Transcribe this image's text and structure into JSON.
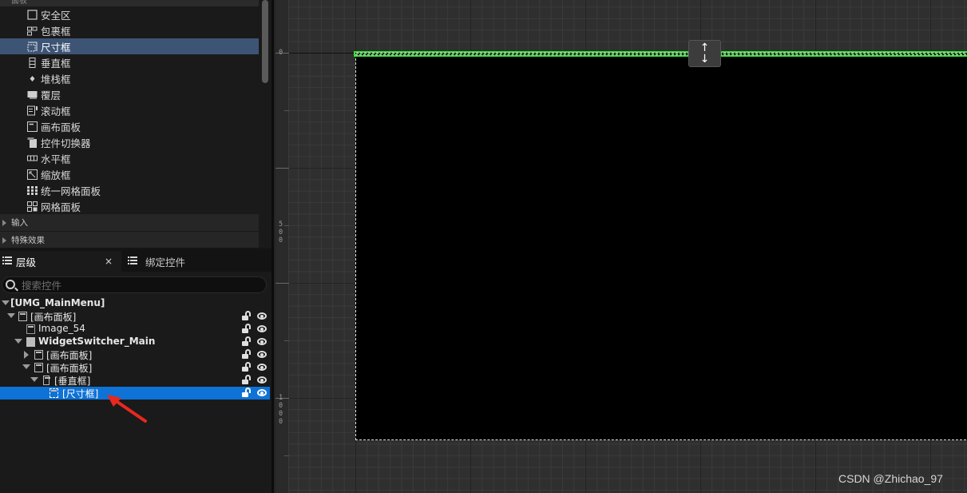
{
  "palette": {
    "top_category": "面板",
    "items": [
      {
        "label": "安全区",
        "icon": "safe-zone-icon"
      },
      {
        "label": "包裹框",
        "icon": "wrap-box-icon"
      },
      {
        "label": "尺寸框",
        "icon": "size-box-icon",
        "selected": true
      },
      {
        "label": "垂直框",
        "icon": "vertical-box-icon"
      },
      {
        "label": "堆栈框",
        "icon": "stack-box-icon"
      },
      {
        "label": "覆层",
        "icon": "overlay-icon"
      },
      {
        "label": "滚动框",
        "icon": "scroll-box-icon"
      },
      {
        "label": "画布面板",
        "icon": "canvas-panel-icon"
      },
      {
        "label": "控件切换器",
        "icon": "widget-switcher-icon"
      },
      {
        "label": "水平框",
        "icon": "horizontal-box-icon"
      },
      {
        "label": "缩放框",
        "icon": "scale-box-icon"
      },
      {
        "label": "统一网格面板",
        "icon": "uniform-grid-icon"
      },
      {
        "label": "网格面板",
        "icon": "grid-panel-icon"
      }
    ],
    "categories": [
      "输入",
      "特殊效果"
    ]
  },
  "hierarchy": {
    "tabs": [
      {
        "label": "层级",
        "active": true
      },
      {
        "label": "绑定控件",
        "active": false
      }
    ],
    "close_label": "×",
    "search_placeholder": "搜索控件",
    "rows": [
      {
        "label": "[UMG_MainMenu]",
        "bold": true
      },
      {
        "label": "[画布面板]"
      },
      {
        "label": "Image_54"
      },
      {
        "label": "WidgetSwitcher_Main",
        "bold": true
      },
      {
        "label": "[画布面板]"
      },
      {
        "label": "[画布面板]"
      },
      {
        "label": "[垂直框]"
      },
      {
        "label": "[尺寸框]",
        "selected": true
      }
    ]
  },
  "designer": {
    "ruler_labels": [
      "0",
      "5\n0\n0",
      "1\n0\n0\n0"
    ],
    "anchor_handle": "↑\n↓",
    "accent": "#2fe82f",
    "canvas_bg": "#000000",
    "selection_color": "#0e72d6"
  },
  "watermark": "CSDN @Zhichao_97"
}
